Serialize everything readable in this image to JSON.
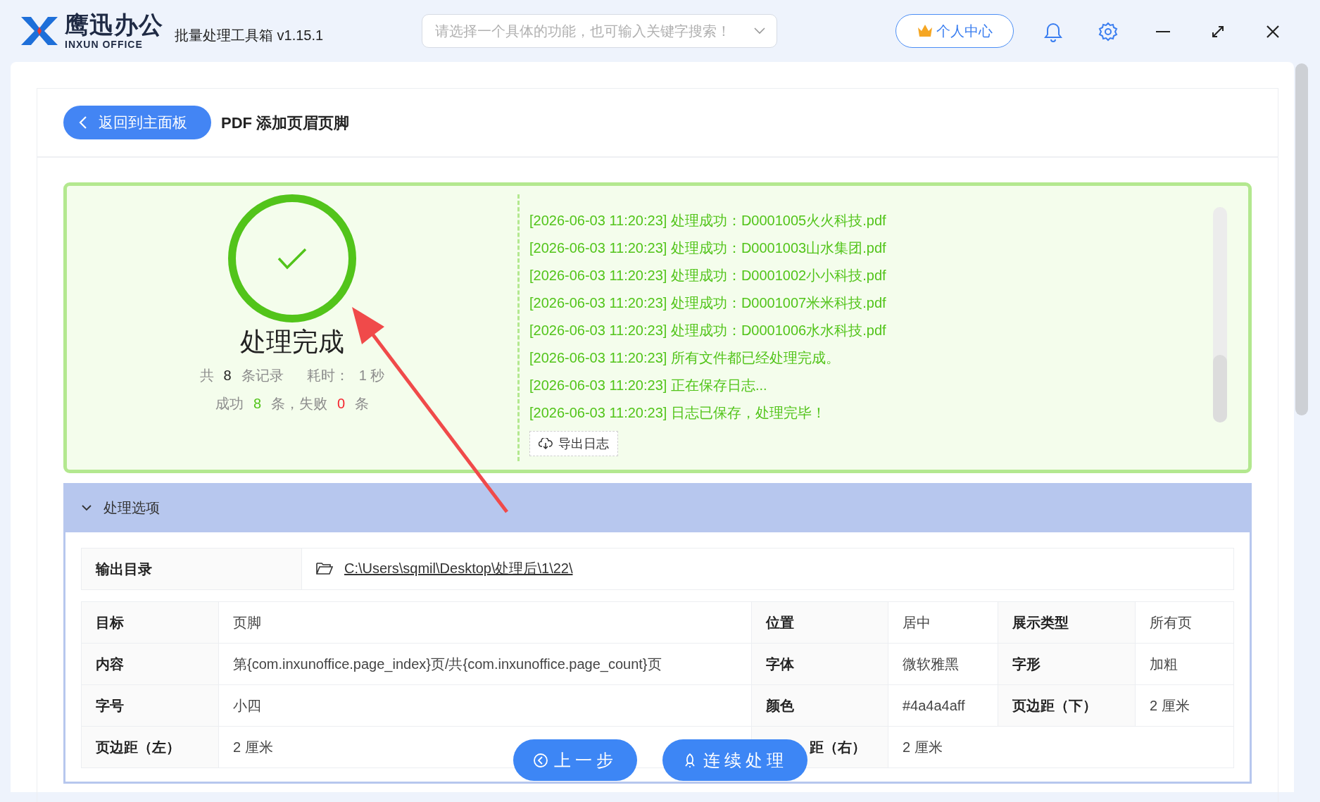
{
  "app": {
    "brand": "鹰迅办公",
    "brand_sub": "INXUN OFFICE",
    "title": "批量处理工具箱 v1.15.1"
  },
  "search": {
    "placeholder": "请选择一个具体的功能，也可输入关键字搜索！"
  },
  "user_button": "个人中心",
  "page": {
    "back_button": "返回到主面板",
    "title": "PDF 添加页眉页脚"
  },
  "result": {
    "status": "处理完成",
    "stats": [
      [
        {
          "kind": "text",
          "text": "共"
        },
        {
          "kind": "count",
          "text": "8"
        },
        {
          "kind": "text",
          "text": "条记录"
        },
        {
          "kind": "gap",
          "text": "耗时："
        },
        {
          "kind": "text",
          "text": "1 秒"
        }
      ],
      [
        {
          "kind": "text",
          "text": "成功"
        },
        {
          "kind": "ok",
          "text": "8"
        },
        {
          "kind": "text",
          "text": "条，失败"
        },
        {
          "kind": "fail",
          "text": "0"
        },
        {
          "kind": "text",
          "text": "条"
        }
      ]
    ],
    "log": [
      "[2026-06-03 11:20:23] 处理成功：D0001005火火科技.pdf",
      "[2026-06-03 11:20:23] 处理成功：D0001003山水集团.pdf",
      "[2026-06-03 11:20:23] 处理成功：D0001002小小科技.pdf",
      "[2026-06-03 11:20:23] 处理成功：D0001007米米科技.pdf",
      "[2026-06-03 11:20:23] 处理成功：D0001006水水科技.pdf",
      "[2026-06-03 11:20:23] 所有文件都已经处理完成。",
      "[2026-06-03 11:20:23] 正在保存日志...",
      "[2026-06-03 11:20:23] 日志已保存，处理完毕！"
    ],
    "export_button": "导出日志"
  },
  "options": {
    "title": "处理选项",
    "expanded": true,
    "output_dir": {
      "label": "输出目录",
      "path": "C:\\Users\\sqmil\\Desktop\\处理后\\1\\22\\"
    },
    "rows": [
      [
        {
          "kind": "label",
          "text": "目标"
        },
        {
          "kind": "value",
          "text": "页脚"
        },
        {
          "kind": "label",
          "text": "位置"
        },
        {
          "kind": "value",
          "text": "居中"
        },
        {
          "kind": "label",
          "text": "展示类型"
        },
        {
          "kind": "value",
          "text": "所有页"
        }
      ],
      [
        {
          "kind": "label",
          "text": "内容"
        },
        {
          "kind": "value",
          "text": "第{com.inxunoffice.page_index}页/共{com.inxunoffice.page_count}页"
        },
        {
          "kind": "label",
          "text": "字体"
        },
        {
          "kind": "value",
          "text": "微软雅黑"
        },
        {
          "kind": "label",
          "text": "字形"
        },
        {
          "kind": "value",
          "text": "加粗"
        }
      ],
      [
        {
          "kind": "label",
          "text": "字号"
        },
        {
          "kind": "value",
          "text": "小四"
        },
        {
          "kind": "label",
          "text": "颜色"
        },
        {
          "kind": "value",
          "text": "#4a4a4aff"
        },
        {
          "kind": "label",
          "text": "页边距（下）"
        },
        {
          "kind": "value",
          "text": "2 厘米"
        }
      ],
      [
        {
          "kind": "label",
          "text": "页边距（左）"
        },
        {
          "kind": "value",
          "text": "2 厘米"
        },
        {
          "kind": "label",
          "text": "距（右）",
          "covered": true
        },
        {
          "kind": "value",
          "text": "2 厘米",
          "colspan": 3
        }
      ]
    ]
  },
  "buttons": [
    {
      "kind": "back",
      "label": "上一步"
    },
    {
      "kind": "rocket",
      "label": "连续处理"
    }
  ]
}
